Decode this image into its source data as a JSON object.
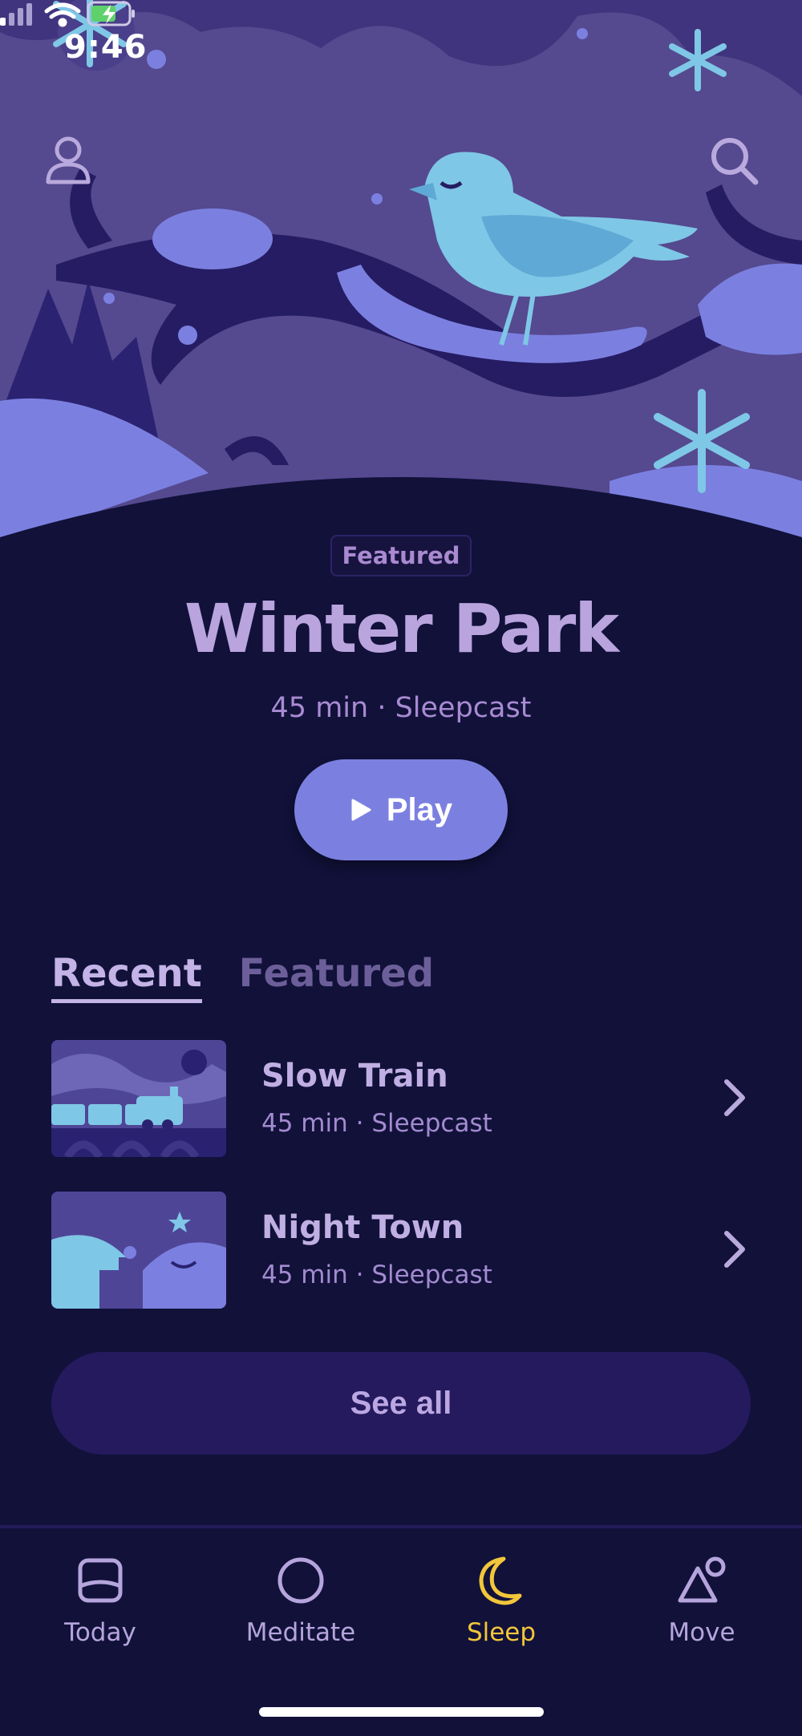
{
  "status_bar": {
    "time": "9:46",
    "icons": [
      "signal-icon",
      "wifi-icon",
      "battery-charging-icon"
    ]
  },
  "header": {
    "profile_icon": "person-icon",
    "search_icon": "search-icon"
  },
  "featured": {
    "badge": "Featured",
    "title": "Winter Park",
    "meta": "45 min · Sleepcast",
    "play_label": "Play"
  },
  "tabs": [
    {
      "label": "Recent",
      "active": true
    },
    {
      "label": "Featured",
      "active": false
    }
  ],
  "list": [
    {
      "title": "Slow Train",
      "meta": "45 min · Sleepcast"
    },
    {
      "title": "Night Town",
      "meta": "45 min · Sleepcast"
    }
  ],
  "see_all_label": "See all",
  "nav": [
    {
      "label": "Today",
      "icon": "today-icon",
      "active": false
    },
    {
      "label": "Meditate",
      "icon": "meditate-circle-icon",
      "active": false
    },
    {
      "label": "Sleep",
      "icon": "moon-icon",
      "active": true
    },
    {
      "label": "Move",
      "icon": "move-shapes-icon",
      "active": false
    }
  ],
  "colors": {
    "background": "#11113a",
    "accent": "#7b80e0",
    "active_nav": "#f2c63b",
    "text": "#b9a4dd"
  }
}
